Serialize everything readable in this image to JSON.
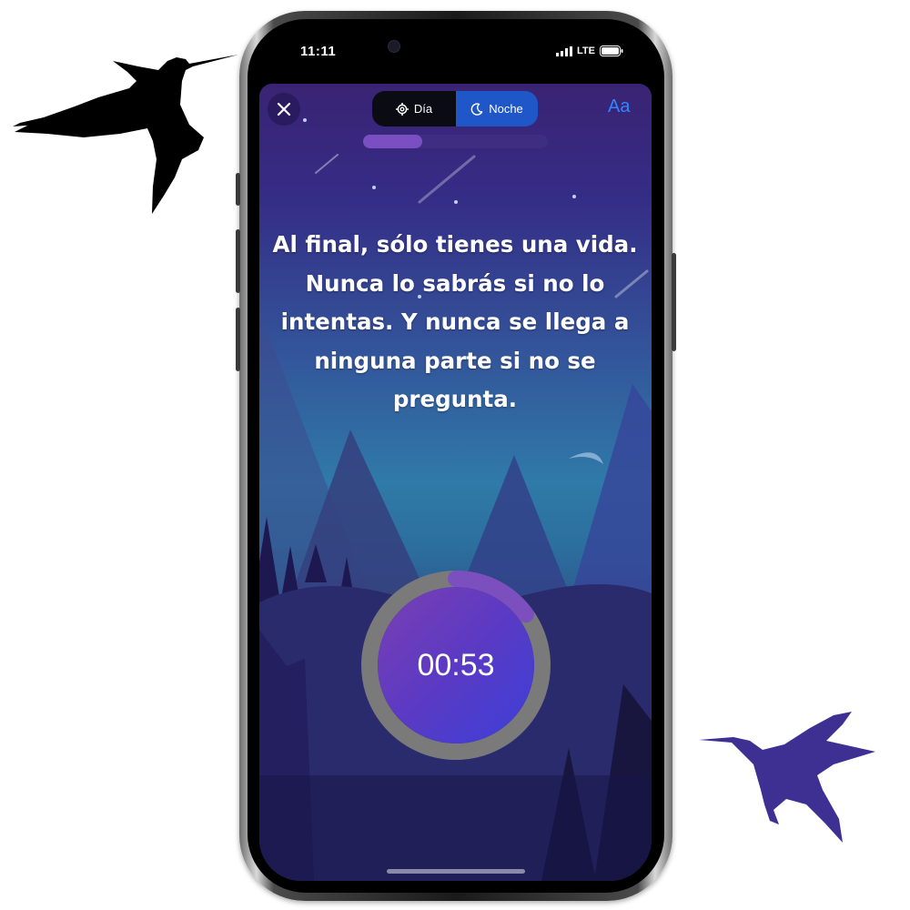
{
  "status_bar": {
    "time": "11:11",
    "network": "LTE"
  },
  "header": {
    "close_icon": "close-icon",
    "mode_day_label": "Día",
    "mode_night_label": "Noche",
    "selected_mode": "Noche",
    "font_button_label": "Aa"
  },
  "progress": {
    "fraction": 0.32
  },
  "quote": {
    "text": "Al final, sólo tienes una vida. Nunca lo sabrás si no lo intentas. Y nunca se llega a ninguna parte si no se pregunta."
  },
  "timer": {
    "display": "00:53",
    "progress_fraction": 0.15
  },
  "colors": {
    "accent": "#2f86ff",
    "night_toggle": "#1f56c8",
    "progress_fill": "#7a4fc2",
    "timer_bg": "#5b3ac4",
    "bird_purple": "#3e2f93"
  }
}
